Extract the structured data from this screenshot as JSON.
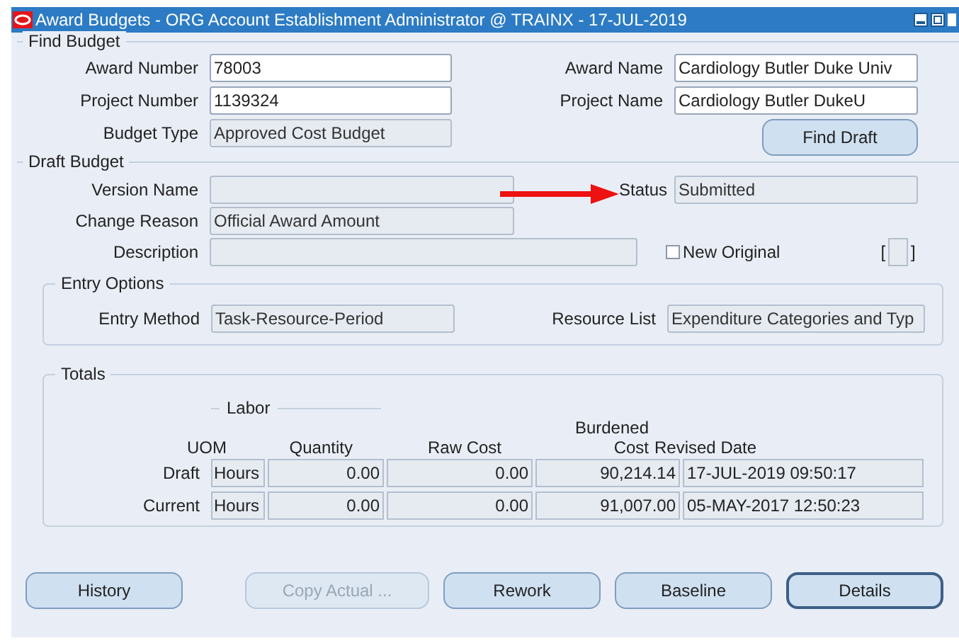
{
  "window": {
    "title": "Award Budgets - ORG Account Establishment Administrator @ TRAINX - 17-JUL-2019"
  },
  "find_budget": {
    "legend": "Find Budget",
    "award_number": {
      "label": "Award Number",
      "value": "78003",
      "editable": true
    },
    "project_number": {
      "label": "Project Number",
      "value": "1139324",
      "editable": true
    },
    "budget_type": {
      "label": "Budget Type",
      "value": "Approved Cost Budget",
      "editable": false
    },
    "award_name": {
      "label": "Award Name",
      "value": "Cardiology Butler Duke Univ",
      "editable": true
    },
    "project_name": {
      "label": "Project Name",
      "value": "Cardiology Butler DukeU",
      "editable": true
    },
    "find_button": {
      "label": "Find Draft",
      "disabled": false,
      "default": false
    }
  },
  "draft_budget": {
    "legend": "Draft Budget",
    "version_name": {
      "label": "Version Name",
      "editable": false
    },
    "status": {
      "label": "Status",
      "value": "Submitted",
      "editable": false
    },
    "change_reason": {
      "label": "Change Reason",
      "value": "Official Award Amount",
      "editable": false
    },
    "description": {
      "label": "Description",
      "editable": false
    },
    "new_original": {
      "label": "New Original",
      "checked": false
    },
    "bracket_left": "[",
    "bracket_right": "]"
  },
  "entry_options": {
    "legend": "Entry Options",
    "entry_method": {
      "label": "Entry Method",
      "value": "Task-Resource-Period",
      "editable": false
    },
    "resource_list": {
      "label": "Resource List",
      "value": "Expenditure Categories and Typ",
      "editable": false
    }
  },
  "totals": {
    "legend": "Totals",
    "group": "Labor",
    "columns": [
      "UOM",
      "Quantity",
      "Raw Cost",
      "Burdened Cost",
      "Revised Date"
    ],
    "rows": [
      {
        "label": "Draft",
        "cells": [
          "Hours",
          "0.00",
          "0.00",
          "90,214.14",
          "17-JUL-2019 09:50:17"
        ]
      },
      {
        "label": "Current",
        "cells": [
          "Hours",
          "0.00",
          "0.00",
          "91,007.00",
          "05-MAY-2017 12:50:23"
        ]
      }
    ]
  },
  "buttons": [
    {
      "label": "History",
      "disabled": false,
      "default": false
    },
    {
      "label": "Copy Actual ...",
      "disabled": true,
      "default": false
    },
    {
      "label": "Rework",
      "disabled": false,
      "default": false
    },
    {
      "label": "Baseline",
      "disabled": false,
      "default": false
    },
    {
      "label": "Details",
      "disabled": false,
      "default": true
    }
  ]
}
